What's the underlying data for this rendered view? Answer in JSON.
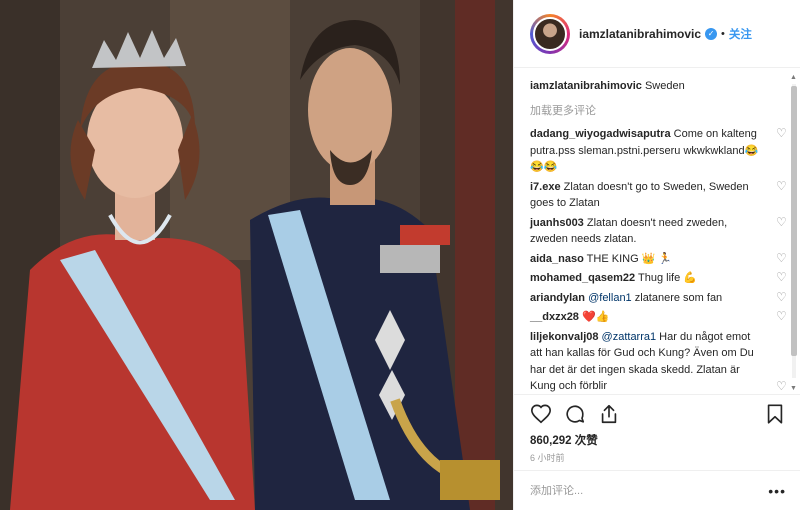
{
  "header": {
    "username": "iamzlatanibrahimovic",
    "separator": "•",
    "follow_label": "关注",
    "verified_glyph": "✓"
  },
  "caption": {
    "username": "iamzlatanibrahimovic",
    "text": "Sweden"
  },
  "load_more": "加载更多评论",
  "comments": [
    {
      "user": "dadang_wiyogadwisaputra",
      "text": "Come on kalteng putra.pss sleman.pstni.perseru wkwkwkland😂😂😂"
    },
    {
      "user": "i7.exe",
      "text": "Zlatan doesn't go to Sweden, Sweden goes to Zlatan"
    },
    {
      "user": "juanhs003",
      "text": "Zlatan doesn't need zweden, zweden needs zlatan."
    },
    {
      "user": "aida_naso",
      "text": "THE KING 👑 🏃"
    },
    {
      "user": "mohamed_qasem22",
      "text": "Thug life 💪"
    },
    {
      "user": "ariandylan",
      "text": "",
      "mention": "@fellan1",
      "after": " zlatanere som fan"
    },
    {
      "user": "__dxzx28",
      "text": "❤️👍"
    },
    {
      "user": "liljekonvalj08",
      "text": "",
      "mention": "@zattarra1",
      "after": " Har du något emot att han kallas för Gud och Kung? Även om Du har det är det ingen skada skedd. Zlatan är Kung och förblir"
    }
  ],
  "likes_text": "860,292 次赞",
  "time_text": "6 小时前",
  "add_comment_placeholder": "添加评论...",
  "more_glyph": "•••",
  "icons": {
    "like": "heart-icon",
    "comment": "comment-icon",
    "share": "share-icon",
    "save": "bookmark-icon",
    "comment_like": "small-heart-icon"
  },
  "colors": {
    "link_blue": "#3897f0",
    "mention_blue": "#003569",
    "meta_gray": "#999999",
    "border": "#efefef"
  }
}
